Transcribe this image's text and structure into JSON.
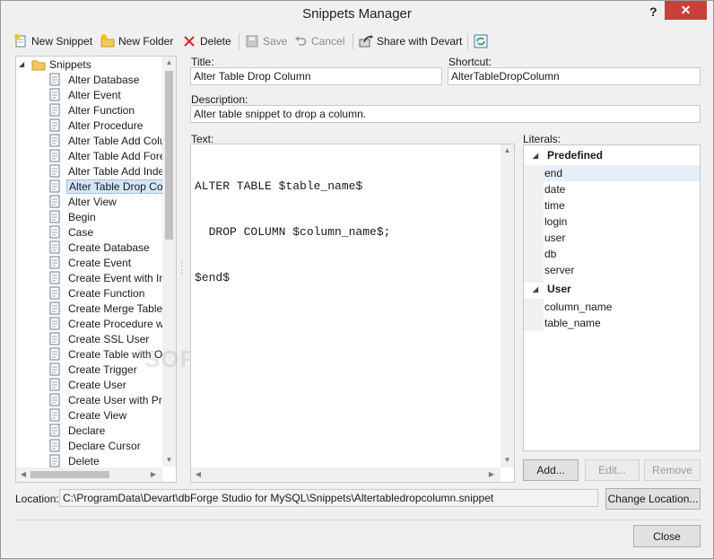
{
  "window": {
    "title": "Snippets Manager",
    "help": "?",
    "close": "✕"
  },
  "toolbar": {
    "new_snippet": "New Snippet",
    "new_folder": "New Folder",
    "delete": "Delete",
    "save": "Save",
    "cancel": "Cancel",
    "share": "Share with Devart"
  },
  "tree": {
    "root": "Snippets",
    "items": [
      "Alter Database",
      "Alter Event",
      "Alter Function",
      "Alter Procedure",
      "Alter Table Add Colu",
      "Alter Table Add Fore",
      "Alter Table Add Inde",
      "Alter Table Drop Col",
      "Alter View",
      "Begin",
      "Case",
      "Create Database",
      "Create Event",
      "Create Event with Int",
      "Create Function",
      "Create Merge Table",
      "Create Procedure wit",
      "Create SSL User",
      "Create Table with Op",
      "Create Trigger",
      "Create User",
      "Create User with Priv",
      "Create View",
      "Declare",
      "Declare Cursor",
      "Delete"
    ],
    "selected_index": 7
  },
  "form": {
    "title_label": "Title:",
    "title_value": "Alter Table Drop Column",
    "shortcut_label": "Shortcut:",
    "shortcut_value": "AlterTableDropColumn",
    "description_label": "Description:",
    "description_value": "Alter table snippet to drop a column.",
    "text_label": "Text:",
    "code_lines": [
      "ALTER TABLE $table_name$",
      "  DROP COLUMN $column_name$;",
      "$end$"
    ],
    "literals_label": "Literals:"
  },
  "literals": {
    "groups": [
      {
        "name": "Predefined",
        "items": [
          "end",
          "date",
          "time",
          "login",
          "user",
          "db",
          "server"
        ]
      },
      {
        "name": "User",
        "items": [
          "column_name",
          "table_name"
        ]
      }
    ],
    "highlighted": "end"
  },
  "buttons": {
    "add": "Add...",
    "edit": "Edit...",
    "remove": "Remove",
    "change_location": "Change Location...",
    "close": "Close"
  },
  "location": {
    "label": "Location:",
    "path": "C:\\ProgramData\\Devart\\dbForge Studio for MySQL\\Snippets\\Altertabledropcolumn.snippet"
  },
  "watermark": "SOFTPEDIA",
  "colors": {
    "selection": "#d4e6f8",
    "close_button": "#c7403c",
    "delete_icon": "#d03030"
  }
}
